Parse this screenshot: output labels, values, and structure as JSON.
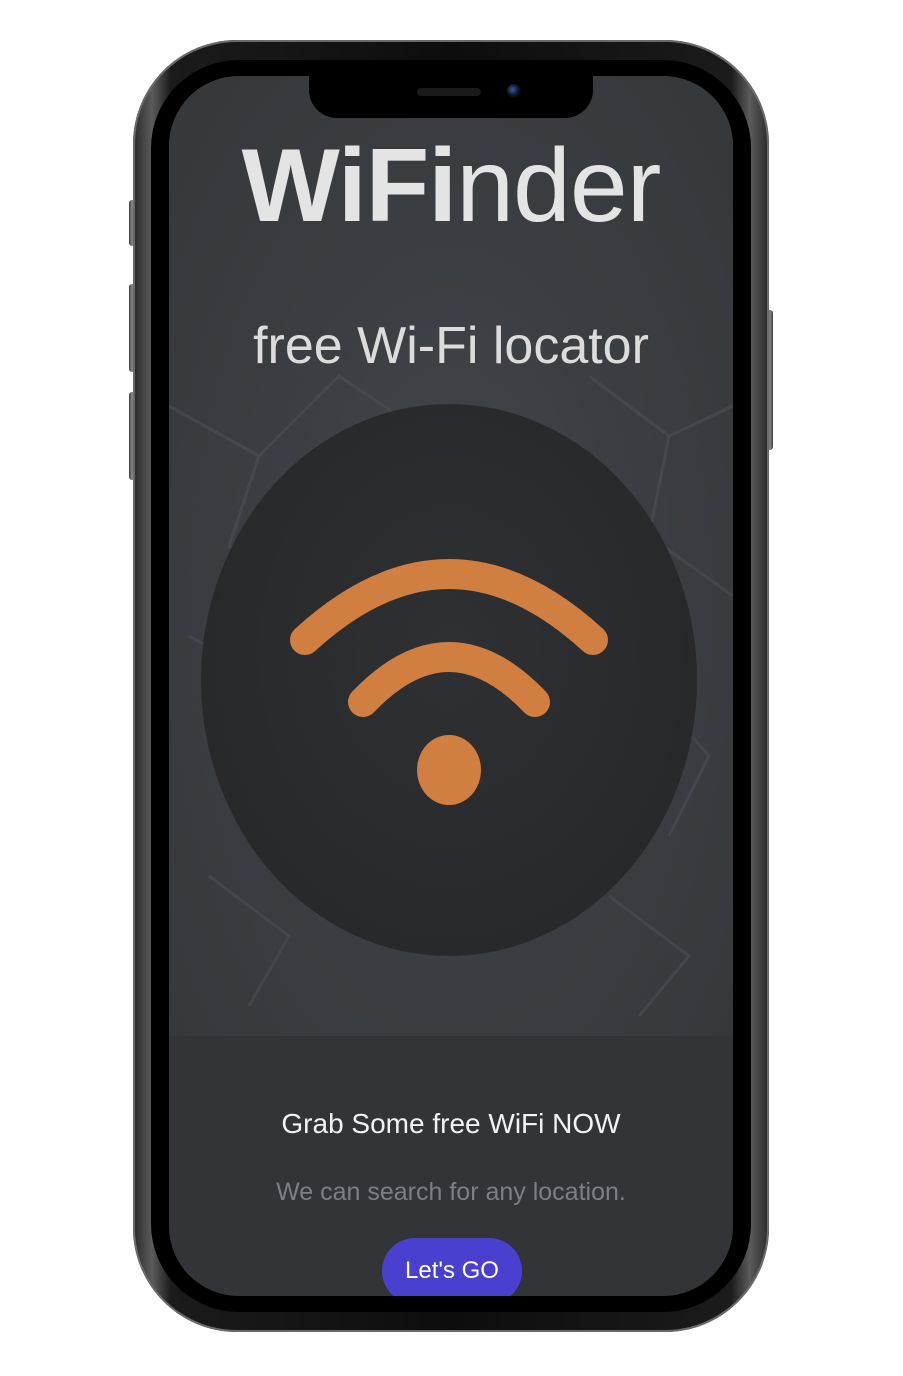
{
  "app": {
    "title_bold": "WiFi",
    "title_rest": "nder",
    "subtitle": "free Wi-Fi locator"
  },
  "hero": {
    "icon": "wifi-icon",
    "icon_color": "#d17e41"
  },
  "footer": {
    "headline": "Grab Some free WiFi NOW",
    "tagline": "We can search for any location.",
    "cta_label": "Let's GO",
    "cta_color": "#4a40d0"
  }
}
